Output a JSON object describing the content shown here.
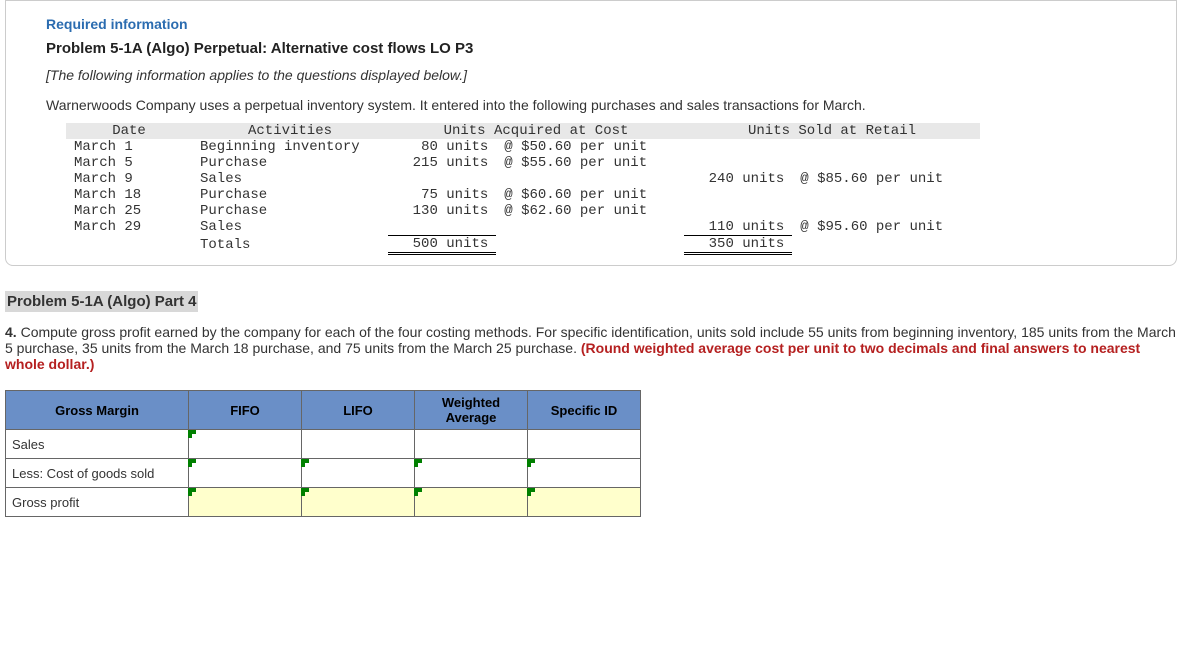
{
  "header": {
    "required": "Required information",
    "title": "Problem 5-1A (Algo) Perpetual: Alternative cost flows LO P3",
    "note": "[The following information applies to the questions displayed below.]",
    "intro": "Warnerwoods Company uses a perpetual inventory system. It entered into the following purchases and sales transactions for March."
  },
  "table1": {
    "h_date": "Date",
    "h_act": "Activities",
    "h_acq": "Units Acquired at Cost",
    "h_sold": "Units Sold at Retail",
    "rows": [
      {
        "date": "March 1",
        "act": "Beginning inventory",
        "acq_u": "80 units",
        "acq_p": "@ $50.60 per unit",
        "sold_u": "",
        "sold_p": ""
      },
      {
        "date": "March 5",
        "act": "Purchase",
        "acq_u": "215 units",
        "acq_p": "@ $55.60 per unit",
        "sold_u": "",
        "sold_p": ""
      },
      {
        "date": "March 9",
        "act": "Sales",
        "acq_u": "",
        "acq_p": "",
        "sold_u": "240 units",
        "sold_p": "@ $85.60 per unit"
      },
      {
        "date": "March 18",
        "act": "Purchase",
        "acq_u": "75 units",
        "acq_p": "@ $60.60 per unit",
        "sold_u": "",
        "sold_p": ""
      },
      {
        "date": "March 25",
        "act": "Purchase",
        "acq_u": "130 units",
        "acq_p": "@ $62.60 per unit",
        "sold_u": "",
        "sold_p": ""
      },
      {
        "date": "March 29",
        "act": "Sales",
        "acq_u": "",
        "acq_p": "",
        "sold_u": "110 units",
        "sold_p": "@ $95.60 per unit"
      }
    ],
    "totals_label": "Totals",
    "totals_acq": "500 units",
    "totals_sold": "350 units"
  },
  "part": {
    "heading": "Problem 5-1A (Algo) Part 4",
    "q_prefix": "4. ",
    "q_body1": "Compute gross profit earned by the company for each of the four costing methods. For specific identification, units sold include 55 units from beginning inventory, 185 units from the March 5 purchase, 35 units from the March 18 purchase, and 75 units from the March 25 purchase. ",
    "q_bold": "(Round weighted average cost per unit to two decimals and final answers to nearest whole dollar.)"
  },
  "answer": {
    "h_gm": "Gross Margin",
    "h_fifo": "FIFO",
    "h_lifo": "LIFO",
    "h_wa": "Weighted Average",
    "h_sid": "Specific ID",
    "r1": "Sales",
    "r2": "Less: Cost of goods sold",
    "r3": "Gross profit"
  }
}
